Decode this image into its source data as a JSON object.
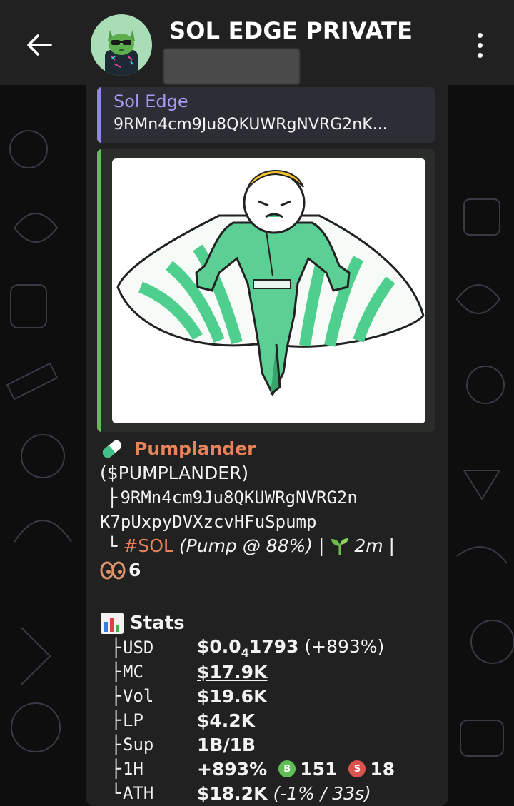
{
  "header": {
    "title": "SOL EDGE PRIVATE",
    "back_icon": "arrow-left-icon",
    "menu_icon": "more-vertical-icon"
  },
  "reply": {
    "name": "Sol Edge",
    "text": "9RMn4cm9Ju8QKUWRgNVRG2nK..."
  },
  "message": {
    "token_name": "Pumplander",
    "ticker": "($PUMPLANDER)",
    "address_prefix": "├",
    "address_line1": "9RMn4cm9Ju8QKUWRgNVRG2n",
    "address_line2": "K7pUxpyDVXzcvHFuSpump",
    "chain_prefix": "└",
    "chain_tag": "#SOL",
    "pump_info": "(Pump @ 88%)",
    "separator1": " | ",
    "age": "2m",
    "separator2": " |",
    "watchers": "6"
  },
  "stats": {
    "header": "Stats",
    "rows": [
      {
        "tree": "├",
        "key": "USD",
        "value": "$0.0",
        "sub": "4",
        "value2": "1793",
        "extra": " (+893%)"
      },
      {
        "tree": "├",
        "key": "MC",
        "value": "$17.9K"
      },
      {
        "tree": "├",
        "key": "Vol",
        "value": "$19.6K"
      },
      {
        "tree": "├",
        "key": "LP",
        "value": "$4.2K"
      },
      {
        "tree": "├",
        "key": "Sup",
        "value": "1B/1B"
      },
      {
        "tree": "├",
        "key": "1H",
        "value": "+893%",
        "buy_label": "B",
        "buys": "151",
        "sell_label": "S",
        "sells": "18"
      },
      {
        "tree": "└",
        "key": "ATH",
        "value": "$18.2K",
        "extra": "(-1% / 33s)"
      }
    ]
  },
  "colors": {
    "header_bg": "#212121",
    "bubble_bg": "#212121",
    "reply_accent": "#8e86e8",
    "preview_accent": "#5fbf56",
    "token_color": "#e8845a"
  }
}
